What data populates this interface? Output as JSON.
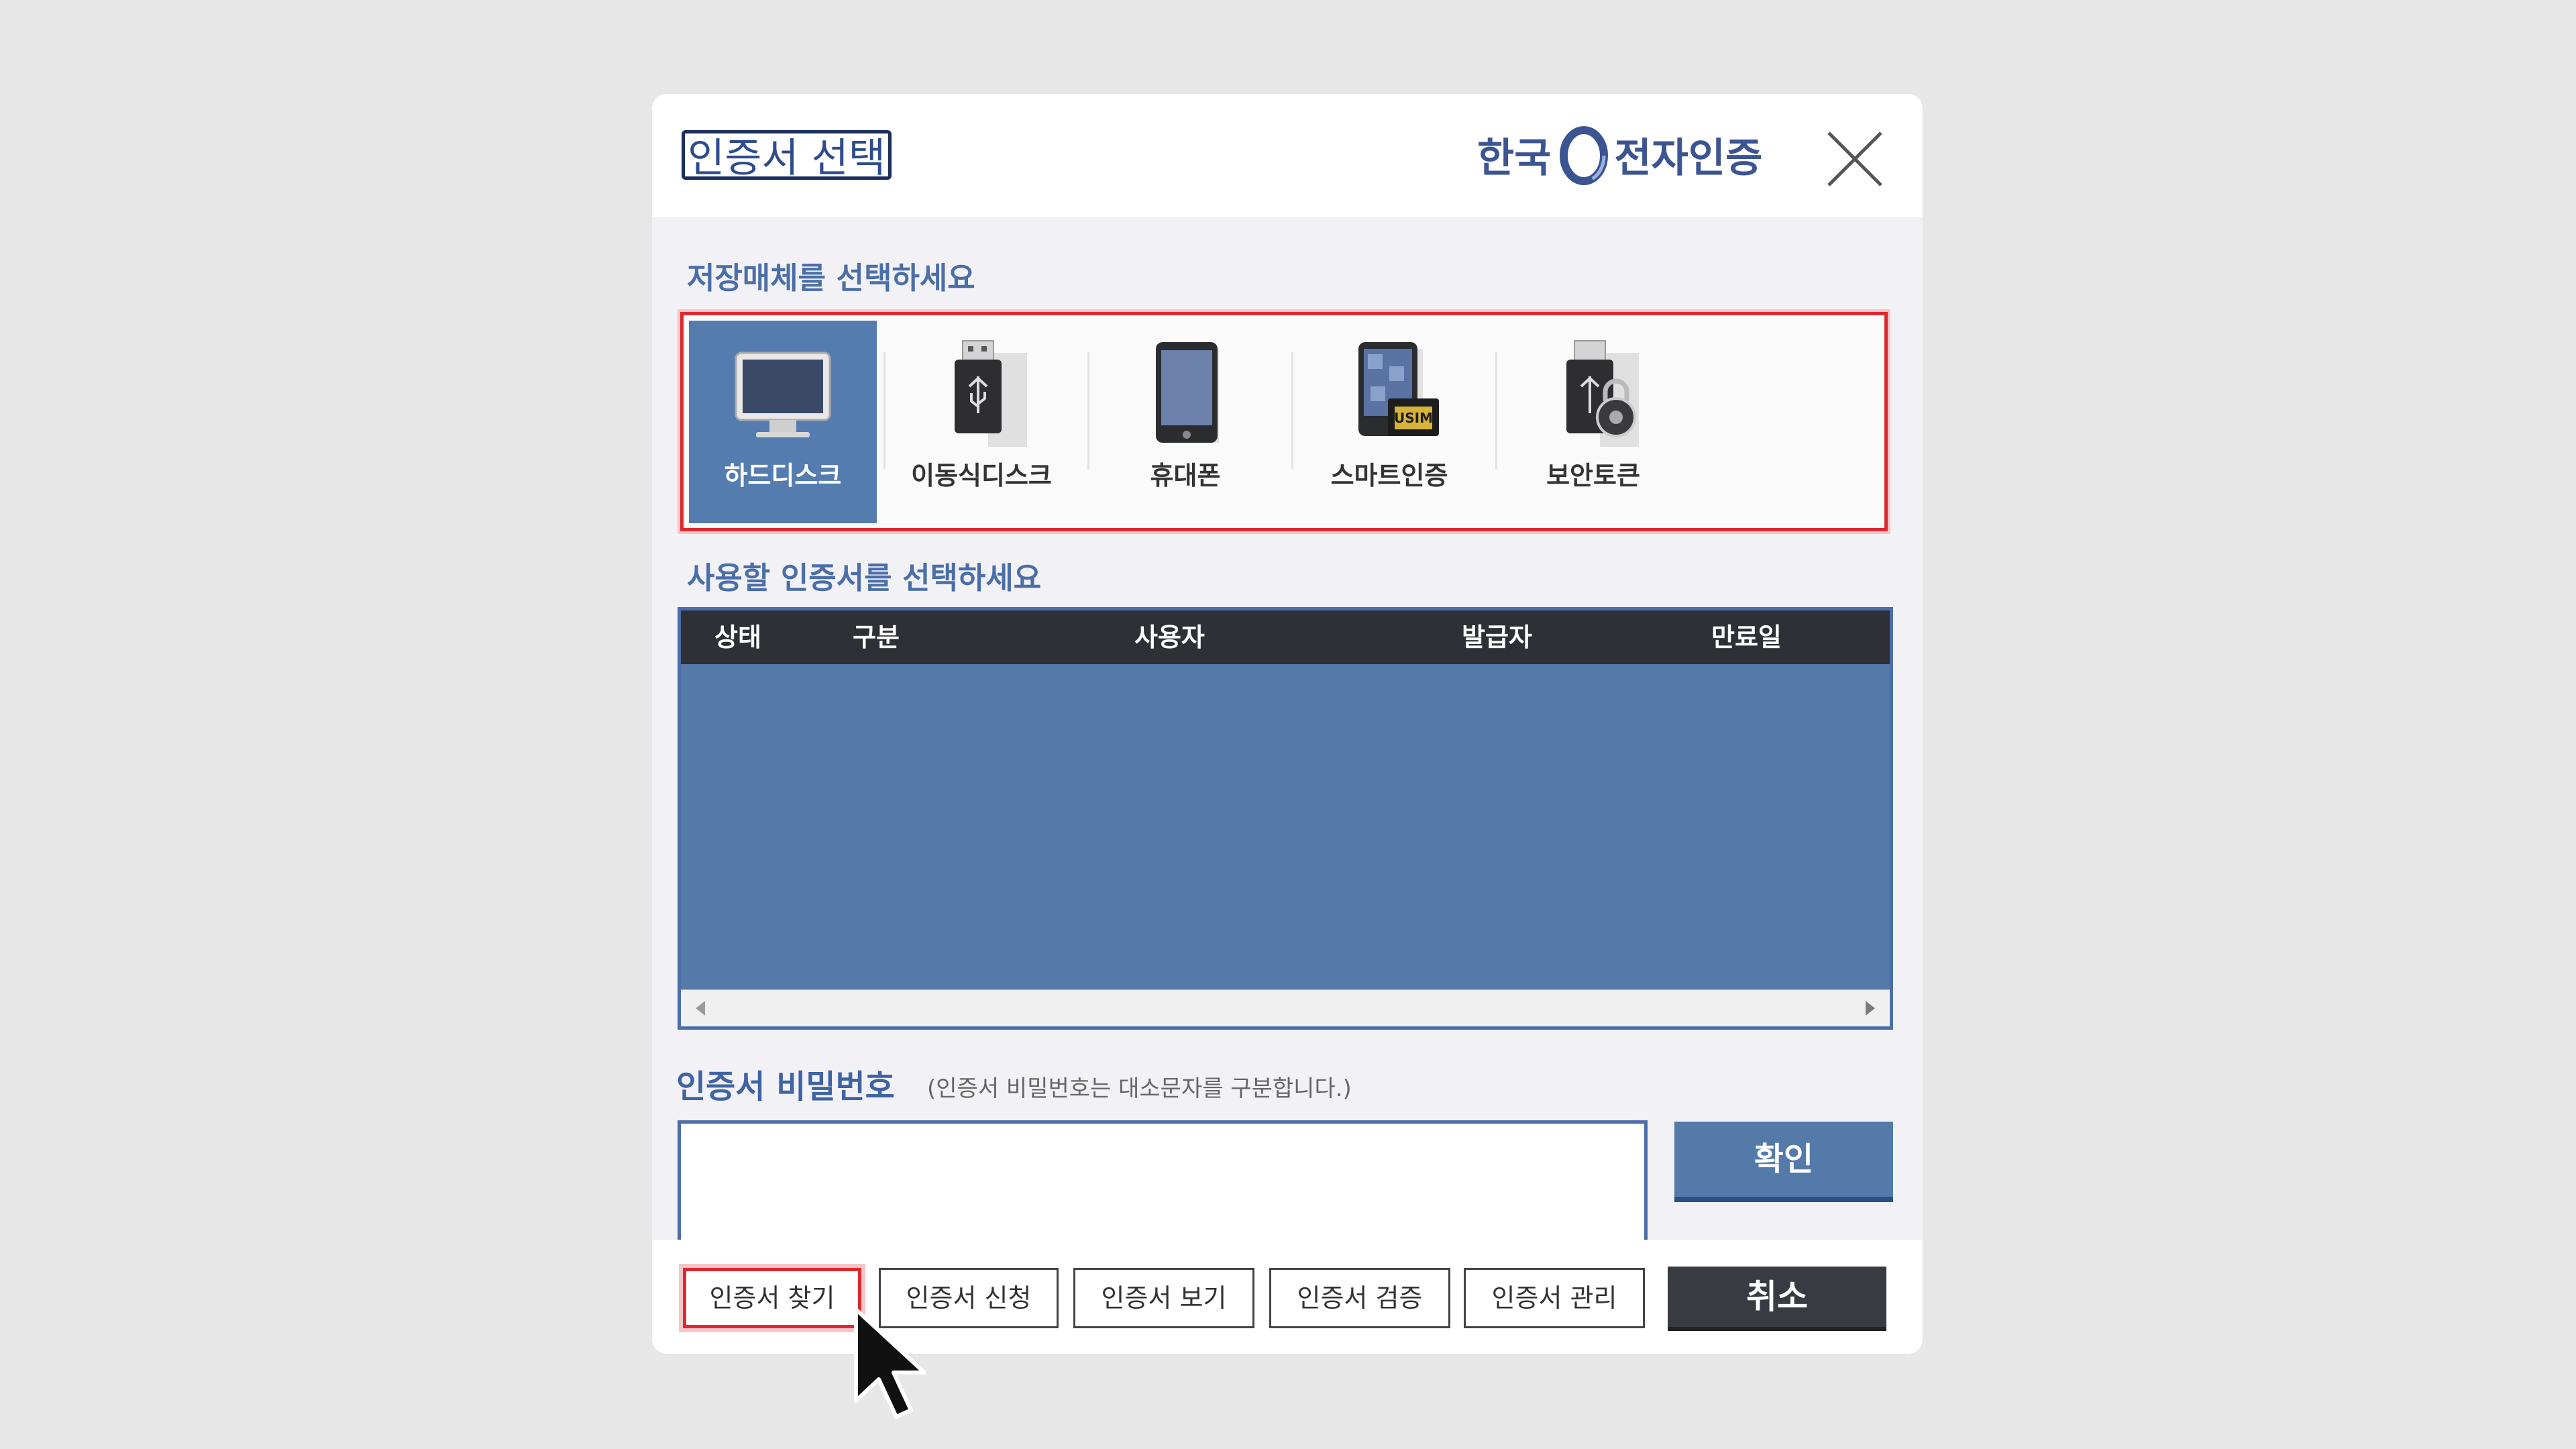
{
  "dialog": {
    "title": "인증서 선택",
    "brand": {
      "part1": "한국",
      "part2": "전자인증"
    }
  },
  "media": {
    "label": "저장매체를 선택하세요",
    "items": [
      {
        "label": "하드디스크",
        "icon": "monitor-icon",
        "selected": true
      },
      {
        "label": "이동식디스크",
        "icon": "usb-drive-icon",
        "selected": false
      },
      {
        "label": "휴대폰",
        "icon": "phone-icon",
        "selected": false
      },
      {
        "label": "스마트인증",
        "icon": "usim-card-icon",
        "selected": false
      },
      {
        "label": "보안토큰",
        "icon": "secure-token-icon",
        "selected": false
      }
    ]
  },
  "certificates": {
    "label": "사용할 인증서를 선택하세요",
    "columns": [
      "상태",
      "구분",
      "사용자",
      "발급자",
      "만료일"
    ],
    "rows": []
  },
  "password": {
    "label": "인증서 비밀번호",
    "hint": "(인증서 비밀번호는 대소문자를 구분합니다.)",
    "value": "",
    "placeholder": "",
    "confirm_label": "확인"
  },
  "actions": {
    "find": "인증서 찾기",
    "apply": "인증서 신청",
    "view": "인증서 보기",
    "verify": "인증서 검증",
    "manage": "인증서 관리",
    "cancel": "취소"
  },
  "colors": {
    "accent": "#547aaa",
    "highlight": "#dd2a31",
    "header_dark": "#2f3036"
  }
}
